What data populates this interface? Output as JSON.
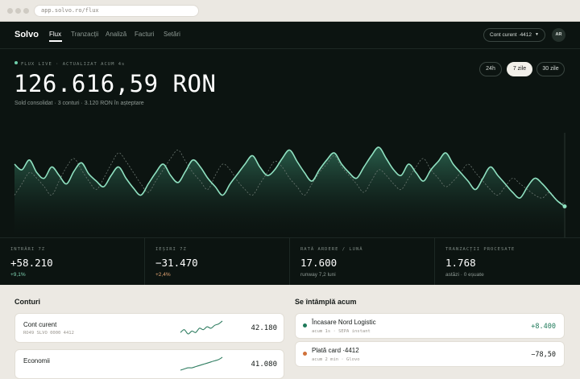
{
  "browser": {
    "url": "app.solvo.ro/flux"
  },
  "nav": {
    "logo": "Solvo",
    "items": [
      "Flux",
      "Tranzacții",
      "Analiză",
      "Facturi",
      "Setări"
    ],
    "account_select": "Cont curent ·4412",
    "avatar_initials": "AR"
  },
  "hero": {
    "live_label": "FLUX LIVE · ACTUALIZAT ACUM 4s",
    "balance": "126.616,59 RON",
    "subline": "Sold consolidat · 3 conturi · 3.120 RON în așteptare",
    "ranges": [
      "24h",
      "7 zile",
      "30 zile"
    ],
    "active_range": "7 zile"
  },
  "chart_data": {
    "type": "area",
    "series": [
      {
        "values": [
          52,
          48,
          55,
          46,
          42,
          50,
          44,
          38,
          47,
          53,
          45,
          40,
          36,
          44,
          50,
          42,
          35,
          30,
          38,
          46,
          52,
          44,
          39,
          47,
          55,
          50,
          42,
          36,
          30,
          38,
          45,
          52,
          58,
          50,
          44,
          48,
          56,
          62,
          54,
          46,
          40,
          48,
          55,
          60,
          52,
          46,
          42,
          50,
          58,
          64,
          56,
          48,
          44,
          52,
          46,
          40,
          48,
          54,
          60,
          52,
          46,
          40,
          34,
          42,
          50,
          44,
          38,
          32,
          28,
          36,
          42,
          38,
          32,
          26,
          22
        ]
      },
      {
        "values": [
          30,
          38,
          46,
          42,
          36,
          30,
          40,
          50,
          56,
          48,
          40,
          34,
          42,
          52,
          60,
          54,
          46,
          38,
          32,
          40,
          48,
          56,
          62,
          54,
          46,
          40,
          34,
          44,
          52,
          48,
          40,
          34,
          30,
          38,
          46,
          54,
          50,
          42,
          36,
          30,
          38,
          46,
          52,
          58,
          50,
          44,
          38,
          32,
          40,
          48,
          44,
          38,
          34,
          42,
          50,
          56,
          48,
          42,
          36,
          40,
          46,
          52,
          46,
          40,
          34,
          30,
          36,
          42,
          38,
          34,
          30,
          28,
          32,
          26,
          24
        ]
      }
    ],
    "ylim": [
      0,
      80
    ]
  },
  "stats": [
    {
      "label": "INTRĂRI 7Z",
      "value": "+58.210",
      "sub": "+9,1%",
      "sub_color": "#7fd3b2"
    },
    {
      "label": "IEȘIRI 7Z",
      "value": "−31.470",
      "sub": "+2,4%",
      "sub_color": "#e0a372"
    },
    {
      "label": "RATĂ ARDERE / LUNĂ",
      "value": "17.600",
      "sub": "runway 7,2 luni",
      "sub_color": "#8f9a95"
    },
    {
      "label": "TRANZACȚII PROCESATE",
      "value": "1.768",
      "sub": "astăzi · 0 eșuate",
      "sub_color": "#8f9a95"
    }
  ],
  "accounts": {
    "title": "Conturi",
    "items": [
      {
        "name": "Cont curent",
        "iban": "RO49 SLVO 0000 4412",
        "amount": "42.180",
        "spark": [
          10,
          12,
          9,
          11,
          10,
          13,
          12,
          14,
          13,
          15,
          16,
          18
        ]
      },
      {
        "name": "Economii",
        "iban": "",
        "amount": "41.080",
        "spark": [
          6,
          7,
          8,
          8,
          9,
          10,
          11,
          12,
          13,
          14,
          15,
          17
        ]
      }
    ]
  },
  "events": {
    "title": "Se întâmplă acum",
    "items": [
      {
        "title": "Încasare Nord Logistic",
        "sub": "acum 1s · SEPA instant",
        "amount": "+8.400",
        "color": "#1f7a5a",
        "dot": "#1f7a5a"
      },
      {
        "title": "Plată card ·4412",
        "sub": "acum 2 min · Glovo",
        "amount": "−78,50",
        "color": "#151a18",
        "dot": "#d0713a"
      }
    ]
  }
}
